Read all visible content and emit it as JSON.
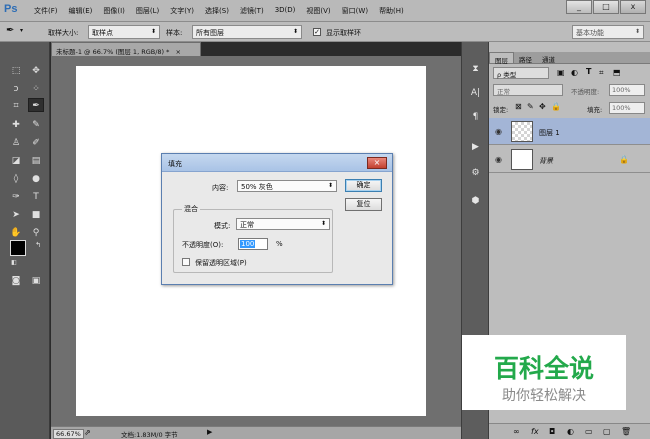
{
  "app": {
    "logo": "Ps",
    "menu": [
      "文件(F)",
      "编辑(E)",
      "图像(I)",
      "图层(L)",
      "文字(Y)",
      "选择(S)",
      "滤镜(T)",
      "3D(D)",
      "视图(V)",
      "窗口(W)",
      "帮助(H)"
    ],
    "window_controls": [
      "_",
      "□",
      "x"
    ]
  },
  "options_bar": {
    "sample_size_label": "取样大小:",
    "sample_size_value": "取样点",
    "sample_label": "样本:",
    "sample_value": "所有图层",
    "show_ring_label": "显示取样环",
    "show_ring_checked": true,
    "workspace_value": "基本功能"
  },
  "document": {
    "tab_title": "未标题-1 @ 66.7% (图层 1, RGB/8) *",
    "tab_close": "×"
  },
  "status_bar": {
    "zoom": "66.67%",
    "doc_info": "文档:1.83M/0 字节"
  },
  "layers_panel": {
    "tabs": [
      "图层",
      "路径",
      "通道"
    ],
    "kind_filter": "ρ 类型",
    "blend_mode": "正常",
    "opacity_label": "不透明度:",
    "opacity_value": "100%",
    "lock_label": "锁定:",
    "fill_label": "填充:",
    "fill_value": "100%",
    "layers": [
      {
        "name": "图层 1",
        "selected": true,
        "locked": false
      },
      {
        "name": "背景",
        "selected": false,
        "locked": true
      }
    ]
  },
  "fill_dialog": {
    "title": "填充",
    "contents_label": "内容:",
    "contents_value": "50% 灰色",
    "ok_label": "确定",
    "reset_label": "复位",
    "blending_label": "混合",
    "mode_label": "模式:",
    "mode_value": "正常",
    "opacity_label": "不透明度(O):",
    "opacity_value": "100",
    "opacity_unit": "%",
    "preserve_label": "保留透明区域(P)",
    "preserve_checked": false
  },
  "watermark": {
    "main": "百科全说",
    "sub": "助你轻松解决"
  },
  "colors": {
    "accent": "#3c7fb1",
    "selected_layer": "#a3b5d6",
    "watermark_green": "#23a94b"
  }
}
